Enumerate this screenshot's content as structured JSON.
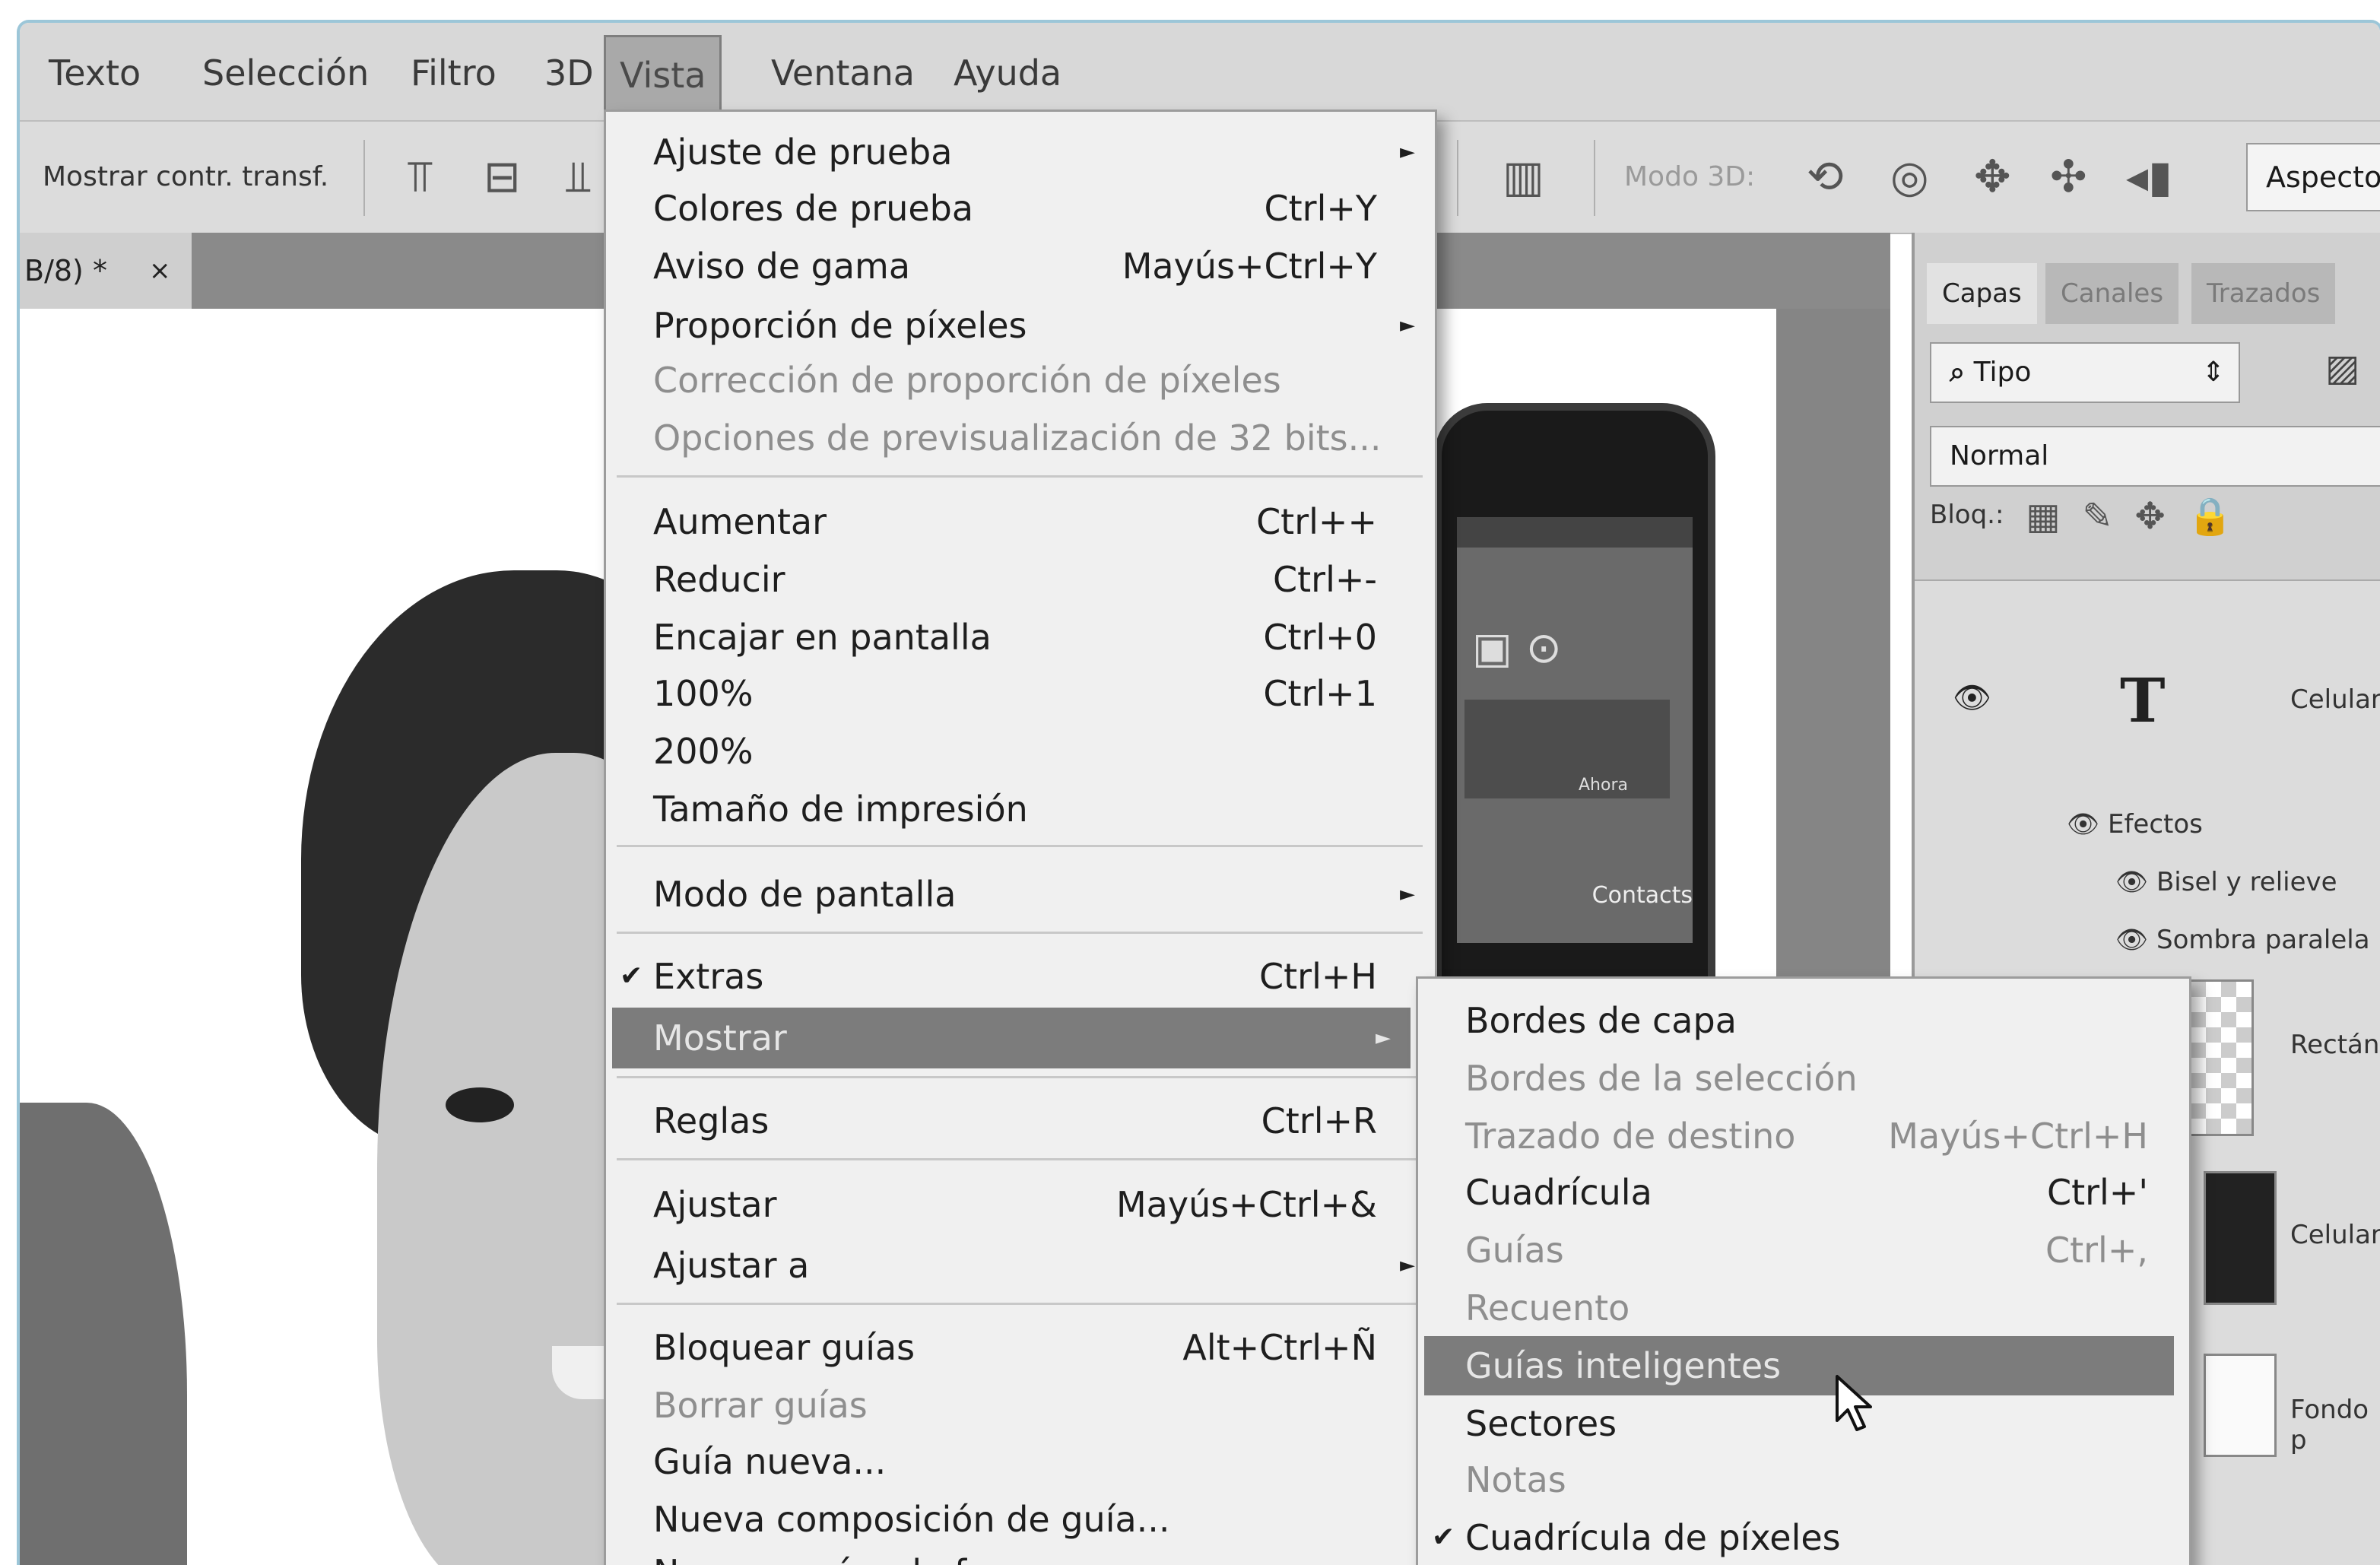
{
  "menubar": {
    "items": [
      "Texto",
      "Selección",
      "Filtro",
      "3D",
      "Vista",
      "Ventana",
      "Ayuda"
    ],
    "active": "Vista"
  },
  "options_bar": {
    "transform_label": "Mostrar contr. transf.",
    "mode_3d": "Modo 3D:",
    "aspect": "Aspecto"
  },
  "document": {
    "tab_title": "B/8) *",
    "close": "×",
    "phone_label": "Contacts",
    "phone_tag": "Ahora"
  },
  "layers_panel": {
    "tabs": [
      "Capas",
      "Canales",
      "Trazados"
    ],
    "filter": "Tipo",
    "blend_mode": "Normal",
    "lock_label": "Bloq.:",
    "layer_text_glyph": "T",
    "layers": [
      "Celulares",
      "Rectángulo",
      "Celular",
      "Fondo p"
    ],
    "effects_label": "Efectos",
    "effects": [
      "Bisel y relieve",
      "Sombra paralela"
    ]
  },
  "vista_menu": {
    "items": [
      {
        "label": "Ajuste de prueba",
        "submenu": true
      },
      {
        "label": "Colores de prueba",
        "shortcut": "Ctrl+Y"
      },
      {
        "label": "Aviso de gama",
        "shortcut": "Mayús+Ctrl+Y"
      },
      {
        "label": "Proporción de píxeles",
        "submenu": true
      },
      {
        "label": "Corrección de proporción de píxeles",
        "disabled": true
      },
      {
        "label": "Opciones de previsualización de 32 bits...",
        "disabled": true
      },
      {
        "label": "Aumentar",
        "shortcut": "Ctrl++"
      },
      {
        "label": "Reducir",
        "shortcut": "Ctrl+-"
      },
      {
        "label": "Encajar en pantalla",
        "shortcut": "Ctrl+0"
      },
      {
        "label": "100%",
        "shortcut": "Ctrl+1"
      },
      {
        "label": "200%"
      },
      {
        "label": "Tamaño de impresión"
      },
      {
        "label": "Modo de pantalla",
        "submenu": true
      },
      {
        "label": "Extras",
        "shortcut": "Ctrl+H",
        "checked": true
      },
      {
        "label": "Mostrar",
        "submenu": true,
        "highlighted": true
      },
      {
        "label": "Reglas",
        "shortcut": "Ctrl+R"
      },
      {
        "label": "Ajustar",
        "shortcut": "Mayús+Ctrl+&"
      },
      {
        "label": "Ajustar a",
        "submenu": true
      },
      {
        "label": "Bloquear guías",
        "shortcut": "Alt+Ctrl+Ñ"
      },
      {
        "label": "Borrar guías",
        "disabled": true
      },
      {
        "label": "Guía nueva..."
      },
      {
        "label": "Nueva composición de guía..."
      },
      {
        "label": "Nuevas guías de forma"
      }
    ]
  },
  "mostrar_submenu": {
    "items": [
      {
        "label": "Bordes de capa"
      },
      {
        "label": "Bordes de la selección",
        "disabled": true
      },
      {
        "label": "Trazado de destino",
        "shortcut": "Mayús+Ctrl+H",
        "disabled": true
      },
      {
        "label": "Cuadrícula",
        "shortcut": "Ctrl+'"
      },
      {
        "label": "Guías",
        "shortcut": "Ctrl+,",
        "disabled": true
      },
      {
        "label": "Recuento",
        "disabled": true
      },
      {
        "label": "Guías inteligentes",
        "highlighted": true
      },
      {
        "label": "Sectores"
      },
      {
        "label": "Notas",
        "disabled": true
      },
      {
        "label": "Cuadrícula de píxeles",
        "checked": true
      }
    ]
  },
  "icons": {
    "check": "✔",
    "submenu_arrow": "►",
    "eye": "👁",
    "search": "⌕"
  }
}
